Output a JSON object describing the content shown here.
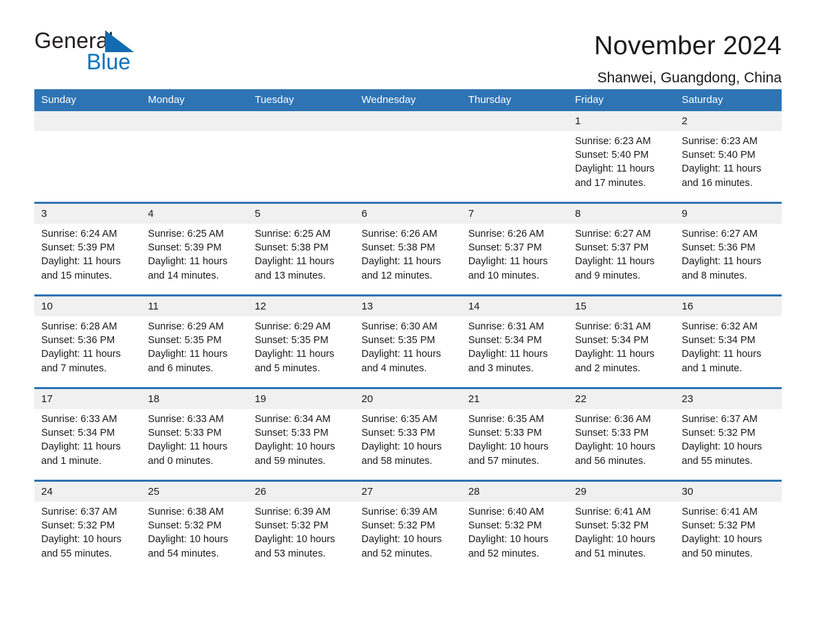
{
  "logo": {
    "word_one": "General",
    "word_two": "Blue",
    "triangle_color": "#136cb0",
    "blue_text_color": "#0b72bb"
  },
  "header": {
    "title": "November 2024",
    "subtitle": "Shanwei, Guangdong, China",
    "accent_color": "#2e74b5",
    "daynum_band_color": "#f0f0f0"
  },
  "weekday_headers": [
    "Sunday",
    "Monday",
    "Tuesday",
    "Wednesday",
    "Thursday",
    "Friday",
    "Saturday"
  ],
  "weeks": [
    [
      {
        "day": "",
        "sunrise": "",
        "sunset": "",
        "daylight_line1": "",
        "daylight_line2": ""
      },
      {
        "day": "",
        "sunrise": "",
        "sunset": "",
        "daylight_line1": "",
        "daylight_line2": ""
      },
      {
        "day": "",
        "sunrise": "",
        "sunset": "",
        "daylight_line1": "",
        "daylight_line2": ""
      },
      {
        "day": "",
        "sunrise": "",
        "sunset": "",
        "daylight_line1": "",
        "daylight_line2": ""
      },
      {
        "day": "",
        "sunrise": "",
        "sunset": "",
        "daylight_line1": "",
        "daylight_line2": ""
      },
      {
        "day": "1",
        "sunrise": "Sunrise: 6:23 AM",
        "sunset": "Sunset: 5:40 PM",
        "daylight_line1": "Daylight: 11 hours",
        "daylight_line2": "and 17 minutes."
      },
      {
        "day": "2",
        "sunrise": "Sunrise: 6:23 AM",
        "sunset": "Sunset: 5:40 PM",
        "daylight_line1": "Daylight: 11 hours",
        "daylight_line2": "and 16 minutes."
      }
    ],
    [
      {
        "day": "3",
        "sunrise": "Sunrise: 6:24 AM",
        "sunset": "Sunset: 5:39 PM",
        "daylight_line1": "Daylight: 11 hours",
        "daylight_line2": "and 15 minutes."
      },
      {
        "day": "4",
        "sunrise": "Sunrise: 6:25 AM",
        "sunset": "Sunset: 5:39 PM",
        "daylight_line1": "Daylight: 11 hours",
        "daylight_line2": "and 14 minutes."
      },
      {
        "day": "5",
        "sunrise": "Sunrise: 6:25 AM",
        "sunset": "Sunset: 5:38 PM",
        "daylight_line1": "Daylight: 11 hours",
        "daylight_line2": "and 13 minutes."
      },
      {
        "day": "6",
        "sunrise": "Sunrise: 6:26 AM",
        "sunset": "Sunset: 5:38 PM",
        "daylight_line1": "Daylight: 11 hours",
        "daylight_line2": "and 12 minutes."
      },
      {
        "day": "7",
        "sunrise": "Sunrise: 6:26 AM",
        "sunset": "Sunset: 5:37 PM",
        "daylight_line1": "Daylight: 11 hours",
        "daylight_line2": "and 10 minutes."
      },
      {
        "day": "8",
        "sunrise": "Sunrise: 6:27 AM",
        "sunset": "Sunset: 5:37 PM",
        "daylight_line1": "Daylight: 11 hours",
        "daylight_line2": "and 9 minutes."
      },
      {
        "day": "9",
        "sunrise": "Sunrise: 6:27 AM",
        "sunset": "Sunset: 5:36 PM",
        "daylight_line1": "Daylight: 11 hours",
        "daylight_line2": "and 8 minutes."
      }
    ],
    [
      {
        "day": "10",
        "sunrise": "Sunrise: 6:28 AM",
        "sunset": "Sunset: 5:36 PM",
        "daylight_line1": "Daylight: 11 hours",
        "daylight_line2": "and 7 minutes."
      },
      {
        "day": "11",
        "sunrise": "Sunrise: 6:29 AM",
        "sunset": "Sunset: 5:35 PM",
        "daylight_line1": "Daylight: 11 hours",
        "daylight_line2": "and 6 minutes."
      },
      {
        "day": "12",
        "sunrise": "Sunrise: 6:29 AM",
        "sunset": "Sunset: 5:35 PM",
        "daylight_line1": "Daylight: 11 hours",
        "daylight_line2": "and 5 minutes."
      },
      {
        "day": "13",
        "sunrise": "Sunrise: 6:30 AM",
        "sunset": "Sunset: 5:35 PM",
        "daylight_line1": "Daylight: 11 hours",
        "daylight_line2": "and 4 minutes."
      },
      {
        "day": "14",
        "sunrise": "Sunrise: 6:31 AM",
        "sunset": "Sunset: 5:34 PM",
        "daylight_line1": "Daylight: 11 hours",
        "daylight_line2": "and 3 minutes."
      },
      {
        "day": "15",
        "sunrise": "Sunrise: 6:31 AM",
        "sunset": "Sunset: 5:34 PM",
        "daylight_line1": "Daylight: 11 hours",
        "daylight_line2": "and 2 minutes."
      },
      {
        "day": "16",
        "sunrise": "Sunrise: 6:32 AM",
        "sunset": "Sunset: 5:34 PM",
        "daylight_line1": "Daylight: 11 hours",
        "daylight_line2": "and 1 minute."
      }
    ],
    [
      {
        "day": "17",
        "sunrise": "Sunrise: 6:33 AM",
        "sunset": "Sunset: 5:34 PM",
        "daylight_line1": "Daylight: 11 hours",
        "daylight_line2": "and 1 minute."
      },
      {
        "day": "18",
        "sunrise": "Sunrise: 6:33 AM",
        "sunset": "Sunset: 5:33 PM",
        "daylight_line1": "Daylight: 11 hours",
        "daylight_line2": "and 0 minutes."
      },
      {
        "day": "19",
        "sunrise": "Sunrise: 6:34 AM",
        "sunset": "Sunset: 5:33 PM",
        "daylight_line1": "Daylight: 10 hours",
        "daylight_line2": "and 59 minutes."
      },
      {
        "day": "20",
        "sunrise": "Sunrise: 6:35 AM",
        "sunset": "Sunset: 5:33 PM",
        "daylight_line1": "Daylight: 10 hours",
        "daylight_line2": "and 58 minutes."
      },
      {
        "day": "21",
        "sunrise": "Sunrise: 6:35 AM",
        "sunset": "Sunset: 5:33 PM",
        "daylight_line1": "Daylight: 10 hours",
        "daylight_line2": "and 57 minutes."
      },
      {
        "day": "22",
        "sunrise": "Sunrise: 6:36 AM",
        "sunset": "Sunset: 5:33 PM",
        "daylight_line1": "Daylight: 10 hours",
        "daylight_line2": "and 56 minutes."
      },
      {
        "day": "23",
        "sunrise": "Sunrise: 6:37 AM",
        "sunset": "Sunset: 5:32 PM",
        "daylight_line1": "Daylight: 10 hours",
        "daylight_line2": "and 55 minutes."
      }
    ],
    [
      {
        "day": "24",
        "sunrise": "Sunrise: 6:37 AM",
        "sunset": "Sunset: 5:32 PM",
        "daylight_line1": "Daylight: 10 hours",
        "daylight_line2": "and 55 minutes."
      },
      {
        "day": "25",
        "sunrise": "Sunrise: 6:38 AM",
        "sunset": "Sunset: 5:32 PM",
        "daylight_line1": "Daylight: 10 hours",
        "daylight_line2": "and 54 minutes."
      },
      {
        "day": "26",
        "sunrise": "Sunrise: 6:39 AM",
        "sunset": "Sunset: 5:32 PM",
        "daylight_line1": "Daylight: 10 hours",
        "daylight_line2": "and 53 minutes."
      },
      {
        "day": "27",
        "sunrise": "Sunrise: 6:39 AM",
        "sunset": "Sunset: 5:32 PM",
        "daylight_line1": "Daylight: 10 hours",
        "daylight_line2": "and 52 minutes."
      },
      {
        "day": "28",
        "sunrise": "Sunrise: 6:40 AM",
        "sunset": "Sunset: 5:32 PM",
        "daylight_line1": "Daylight: 10 hours",
        "daylight_line2": "and 52 minutes."
      },
      {
        "day": "29",
        "sunrise": "Sunrise: 6:41 AM",
        "sunset": "Sunset: 5:32 PM",
        "daylight_line1": "Daylight: 10 hours",
        "daylight_line2": "and 51 minutes."
      },
      {
        "day": "30",
        "sunrise": "Sunrise: 6:41 AM",
        "sunset": "Sunset: 5:32 PM",
        "daylight_line1": "Daylight: 10 hours",
        "daylight_line2": "and 50 minutes."
      }
    ]
  ]
}
